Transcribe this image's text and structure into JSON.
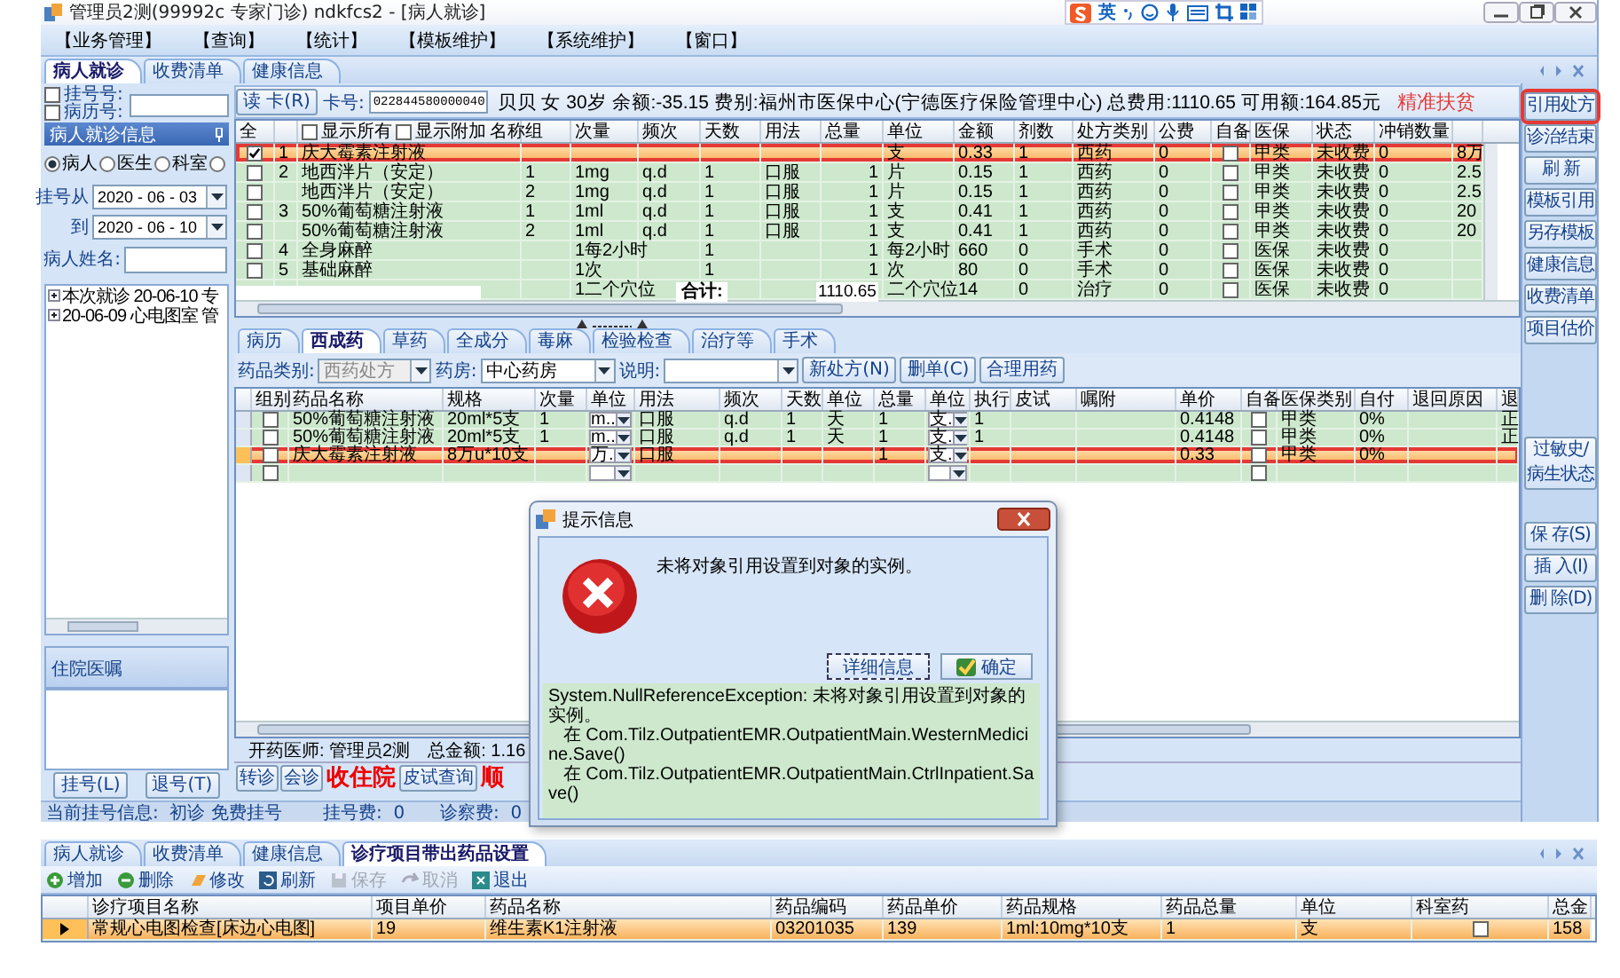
{
  "window": {
    "title": "管理员2测(99992c 专家门诊) ndkfcs2 - [病人就诊]"
  },
  "ime_toolbar": {
    "mode": "英"
  },
  "menu": [
    "【业务管理】",
    "【查询】",
    "【统计】",
    "【模板维护】",
    "【系统维护】",
    "【窗口】"
  ],
  "tabs": [
    {
      "label": "病人就诊",
      "selected": true
    },
    {
      "label": "收费清单",
      "selected": false
    },
    {
      "label": "健康信息",
      "selected": false
    }
  ],
  "registration_search": {
    "fields": [
      {
        "label": "挂号号:",
        "checked": false
      },
      {
        "label": "病历号:",
        "checked": false
      }
    ]
  },
  "visit_panel": {
    "title": "病人就诊信息",
    "filters": [
      {
        "label": "病人",
        "selected": true
      },
      {
        "label": "医生",
        "selected": false
      },
      {
        "label": "科室",
        "selected": false
      },
      {
        "selected": false
      }
    ],
    "date_from": {
      "label": "挂号从",
      "value": "2020 - 06 - 03"
    },
    "date_to": {
      "label": "到",
      "value": "2020 - 06 - 10"
    },
    "patient_name": {
      "label": "病人姓名:"
    },
    "visits": [
      {
        "label": "本次就诊 20-06-10 专"
      },
      {
        "label": "20-06-09 心电图室 管"
      }
    ]
  },
  "inpatient_orders": {
    "title": "住院医嘱"
  },
  "registration_buttons": [
    "挂号(L)",
    "退号(T)"
  ],
  "patient_bar": {
    "read_card": "读 卡(R)",
    "card_label": "卡号:",
    "card_number": "022844580000040",
    "summary": "贝贝 女 30岁 余额:-35.15 费别:福州市医保中心(宁德医疗保险管理中心) 总费用:1110.65 可用额:164.85元",
    "tag": "精准扶贫"
  },
  "upper_grid": {
    "options": [
      {
        "label": "显示所有",
        "checked": false
      },
      {
        "label": "显示附加",
        "checked": false
      }
    ],
    "columns": [
      {
        "label": "全",
        "kind": "check"
      },
      {
        "kind": "text"
      },
      {
        "label": "名称",
        "kind": "text"
      },
      {
        "label": "组",
        "kind": "text"
      },
      {
        "label": "次量",
        "kind": "text"
      },
      {
        "label": "频次",
        "kind": "text"
      },
      {
        "label": "天数",
        "kind": "text"
      },
      {
        "label": "用法",
        "kind": "text"
      },
      {
        "label": "总量",
        "kind": "text"
      },
      {
        "label": "单位",
        "kind": "text"
      },
      {
        "label": "金额",
        "kind": "text"
      },
      {
        "label": "剂数",
        "kind": "text"
      },
      {
        "label": "处方类别",
        "kind": "text"
      },
      {
        "label": "公费",
        "kind": "text"
      },
      {
        "label": "自备",
        "kind": "check"
      },
      {
        "label": "医保",
        "kind": "text"
      },
      {
        "label": "状态",
        "kind": "text"
      },
      {
        "label": "冲销数量",
        "kind": "text"
      },
      {
        "kind": "text"
      }
    ],
    "rows": [
      {
        "selected": true,
        "marked": true,
        "cells": [
          true,
          "1",
          "庆大霉素注射液",
          null,
          null,
          null,
          null,
          null,
          null,
          "支",
          "0.33",
          "1",
          "西药",
          "0",
          false,
          "甲类",
          "未收费",
          "0",
          "8万"
        ]
      },
      {
        "selected": false,
        "marked": false,
        "cells": [
          false,
          "2",
          "地西泮片（安定）",
          "1",
          "1mg",
          "q.d",
          "1",
          "口服",
          "1",
          "片",
          "0.15",
          "1",
          "西药",
          "0",
          false,
          "甲类",
          "未收费",
          "0",
          "2.5"
        ]
      },
      {
        "selected": false,
        "marked": false,
        "cells": [
          false,
          null,
          "地西泮片（安定）",
          "2",
          "1mg",
          "q.d",
          "1",
          "口服",
          "1",
          "片",
          "0.15",
          "1",
          "西药",
          "0",
          false,
          "甲类",
          "未收费",
          "0",
          "2.5"
        ]
      },
      {
        "selected": false,
        "marked": false,
        "cells": [
          false,
          "3",
          "50%葡萄糖注射液",
          "1",
          "1ml",
          "q.d",
          "1",
          "口服",
          "1",
          "支",
          "0.41",
          "1",
          "西药",
          "0",
          false,
          "甲类",
          "未收费",
          "0",
          "20"
        ]
      },
      {
        "selected": false,
        "marked": false,
        "cells": [
          false,
          null,
          "50%葡萄糖注射液",
          "2",
          "1ml",
          "q.d",
          "1",
          "口服",
          "1",
          "支",
          "0.41",
          "1",
          "西药",
          "0",
          false,
          "甲类",
          "未收费",
          "0",
          "20"
        ]
      },
      {
        "selected": false,
        "marked": false,
        "cells": [
          false,
          "4",
          "全身麻醉",
          null,
          "1每2小时",
          null,
          "1",
          null,
          "1",
          "每2小时",
          "660",
          "0",
          "手术",
          "0",
          false,
          "医保",
          "未收费",
          "0",
          null
        ]
      },
      {
        "selected": false,
        "marked": false,
        "cells": [
          false,
          "5",
          "基础麻醉",
          null,
          "1次",
          null,
          "1",
          null,
          "1",
          "次",
          "80",
          "0",
          "手术",
          "0",
          false,
          "医保",
          "未收费",
          "0",
          null
        ]
      },
      {
        "selected": false,
        "marked": false,
        "cells": [
          null,
          null,
          null,
          null,
          "1二个穴位",
          null,
          null,
          null,
          null,
          "二个穴位",
          "14",
          "0",
          "治疗",
          "0",
          false,
          "医保",
          "未收费",
          "0",
          null
        ]
      }
    ],
    "totals": {
      "label": "合计:",
      "value": "1110.65"
    }
  },
  "sidebar": {
    "groups": [
      {
        "buttons": [
          {
            "label": "引用处方",
            "marked": true
          },
          {
            "label": "诊治结束",
            "marked": false
          },
          {
            "label": "刷 新",
            "marked": false
          },
          {
            "label": "模板引用",
            "marked": false
          },
          {
            "label": "另存模板",
            "marked": false
          },
          {
            "label": "健康信息",
            "marked": false
          },
          {
            "label": "收费清单",
            "marked": false
          },
          {
            "label": "项目估价",
            "marked": false
          }
        ]
      },
      {
        "buttons": [
          {
            "label": "过敏史/病生状态",
            "marked": false
          }
        ]
      },
      {
        "buttons": [
          {
            "label": "保 存(S)",
            "marked": false
          },
          {
            "label": "插 入(I)",
            "marked": false
          },
          {
            "label": "删 除(D)",
            "marked": false
          }
        ]
      }
    ]
  },
  "drug_tabs": [
    {
      "label": "病历",
      "selected": false
    },
    {
      "label": "西成药",
      "selected": true
    },
    {
      "label": "草药",
      "selected": false
    },
    {
      "label": "全成分",
      "selected": false
    },
    {
      "label": "毒麻",
      "selected": false
    },
    {
      "label": "检验检查",
      "selected": false
    },
    {
      "label": "治疗等",
      "selected": false
    },
    {
      "label": "手术",
      "selected": false
    }
  ],
  "drug_filters": {
    "category": {
      "label": "药品类别:",
      "value": "西药处方",
      "disabled": true
    },
    "pharmacy": {
      "label": "药房:",
      "value": "中心药房",
      "disabled": false
    },
    "note": {
      "label": "说明:"
    },
    "buttons": [
      "新处方(N)",
      "删单(C)",
      "合理用药"
    ]
  },
  "drug_grid": {
    "columns": [
      {
        "kind": "indicator"
      },
      {
        "label": "组别",
        "kind": "check"
      },
      {
        "label": "药品名称",
        "kind": "text"
      },
      {
        "label": "规格",
        "kind": "text"
      },
      {
        "label": "次量",
        "kind": "text"
      },
      {
        "label": "单位",
        "kind": "dropdown"
      },
      {
        "label": "用法",
        "kind": "text"
      },
      {
        "label": "频次",
        "kind": "text"
      },
      {
        "label": "天数",
        "kind": "text"
      },
      {
        "label": "单位",
        "kind": "text"
      },
      {
        "label": "总量",
        "kind": "text"
      },
      {
        "label": "单位",
        "kind": "dropdown"
      },
      {
        "label": "执行",
        "kind": "text"
      },
      {
        "label": "皮试",
        "kind": "text"
      },
      {
        "label": "嘱附",
        "kind": "text"
      },
      {
        "label": "单价",
        "kind": "text"
      },
      {
        "label": "自备",
        "kind": "check"
      },
      {
        "label": "医保类别",
        "kind": "text"
      },
      {
        "label": "自付",
        "kind": "text"
      },
      {
        "label": "退回原因",
        "kind": "text"
      },
      {
        "label": "退",
        "kind": "text"
      }
    ],
    "rows": [
      {
        "selected": false,
        "marked": false,
        "cells": [
          null,
          false,
          "50%葡萄糖注射液",
          "20ml*5支",
          "1",
          "m..",
          "口服",
          "q.d",
          "1",
          "天",
          "1",
          "支.",
          "1",
          null,
          null,
          "0.4148",
          false,
          "甲类",
          "0%",
          null,
          "正"
        ]
      },
      {
        "selected": false,
        "marked": false,
        "cells": [
          null,
          false,
          "50%葡萄糖注射液",
          "20ml*5支",
          "1",
          "m..",
          "口服",
          "q.d",
          "1",
          "天",
          "1",
          "支.",
          "1",
          null,
          null,
          "0.4148",
          false,
          "甲类",
          "0%",
          null,
          "正"
        ]
      },
      {
        "selected": true,
        "marked": true,
        "cells": [
          null,
          false,
          "庆大霉素注射液",
          "8万u*10支",
          null,
          "万.",
          "口服",
          null,
          null,
          null,
          "1",
          "支.",
          null,
          null,
          null,
          "0.33",
          false,
          "甲类",
          "0%",
          null,
          null
        ]
      },
      {
        "selected": false,
        "marked": false,
        "cells": [
          null,
          false,
          null,
          null,
          null,
          null,
          null,
          null,
          null,
          null,
          null,
          null,
          null,
          null,
          null,
          null,
          false,
          null,
          null,
          null,
          null
        ]
      }
    ]
  },
  "prescription_footer": {
    "doctor": "开药医师: 管理员2测",
    "total": "总金额: 1.16",
    "buttons": [
      {
        "label": "转诊",
        "kind": "normal"
      },
      {
        "label": "会诊",
        "kind": "normal"
      },
      {
        "label": "收住院",
        "kind": "alert"
      },
      {
        "label": "皮试查询",
        "kind": "normal"
      },
      {
        "label": "顺",
        "kind": "alert"
      }
    ]
  },
  "status_bar": {
    "registration": "当前挂号信息:  初诊 免费挂号",
    "registration_fee": "挂号费:  0",
    "exam_fee": "诊察费:  0"
  },
  "dialog": {
    "title": "提示信息",
    "message": "未将对象引用设置到对象的实例。",
    "buttons": [
      {
        "label": "详细信息",
        "kind": "details"
      },
      {
        "label": "确定",
        "kind": "ok"
      }
    ],
    "details": [
      "System.NullReferenceException: 未将对象引用设置到对象的实例。",
      "   在 Com.Tilz.OutpatientEMR.OutpatientMain.WesternMedicine.Save()",
      "   在 Com.Tilz.OutpatientEMR.OutpatientMain.CtrlInpatient.Save()"
    ]
  },
  "settings_window": {
    "tabs": [
      {
        "label": "病人就诊",
        "selected": false
      },
      {
        "label": "收费清单",
        "selected": false
      },
      {
        "label": "健康信息",
        "selected": false
      },
      {
        "label": "诊疗项目带出药品设置",
        "selected": true
      }
    ],
    "toolbar": [
      {
        "label": "增加",
        "kind": "add",
        "disabled": false
      },
      {
        "label": "删除",
        "kind": "delete",
        "disabled": false
      },
      {
        "label": "修改",
        "kind": "edit",
        "disabled": false
      },
      {
        "label": "刷新",
        "kind": "refresh",
        "disabled": false
      },
      {
        "label": "保存",
        "kind": "save",
        "disabled": true
      },
      {
        "label": "取消",
        "kind": "cancel",
        "disabled": true
      },
      {
        "label": "退出",
        "kind": "exit",
        "disabled": false
      }
    ],
    "grid": {
      "columns": [
        {
          "kind": "indicator"
        },
        {
          "label": "诊疗项目名称",
          "kind": "text"
        },
        {
          "label": "项目单价",
          "kind": "text"
        },
        {
          "label": "药品名称",
          "kind": "text"
        },
        {
          "label": "药品编码",
          "kind": "text"
        },
        {
          "label": "药品单价",
          "kind": "text"
        },
        {
          "label": "药品规格",
          "kind": "text"
        },
        {
          "label": "药品总量",
          "kind": "text"
        },
        {
          "label": "单位",
          "kind": "text"
        },
        {
          "label": "科室药",
          "kind": "check"
        },
        {
          "label": "总金",
          "kind": "text"
        }
      ],
      "rows": [
        {
          "selected": true,
          "marked": false,
          "cells": [
            null,
            "常规心电图检查[床边心电图]",
            "19",
            "维生素K1注射液",
            "03201035",
            "139",
            "1ml:10mg*10支",
            "1",
            "支",
            false,
            "158"
          ]
        }
      ]
    }
  }
}
